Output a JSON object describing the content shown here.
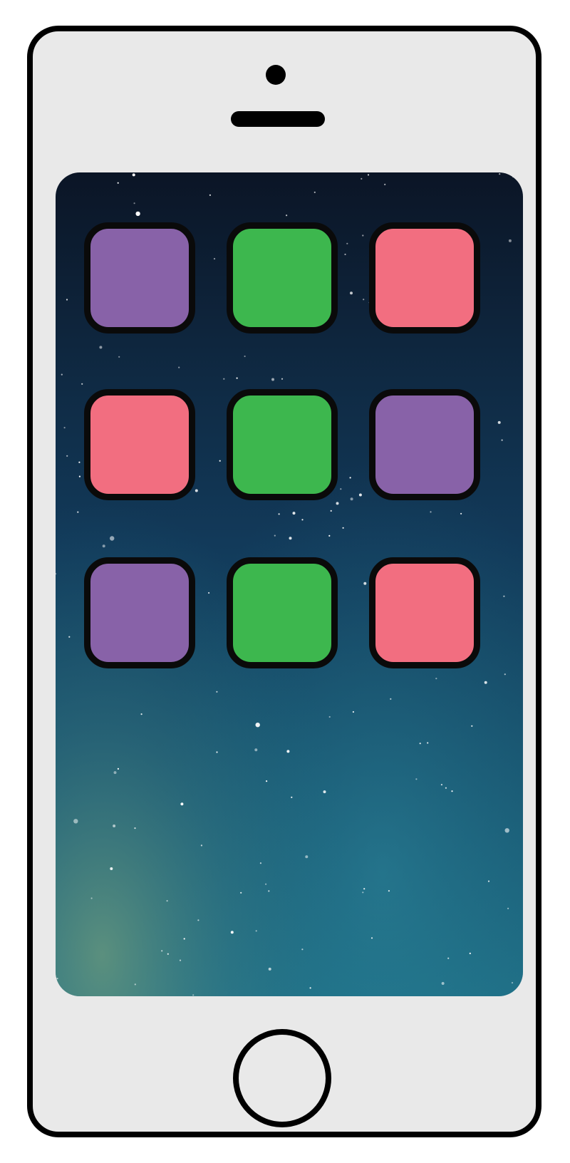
{
  "colors": {
    "phone_body": "#e9e9e9",
    "phone_outline": "#000000",
    "camera": "#000000",
    "speaker": "#000000",
    "wallpaper_top": "#0b1526",
    "wallpaper_mid": "#123a5a",
    "wallpaper_bottom": "#1f6f86",
    "purple": "#8862a8",
    "green": "#3db74e",
    "pink": "#f26e80"
  },
  "wallpaper": {
    "name": "starry-night-wallpaper"
  },
  "apps": [
    {
      "name": "app-icon-purple",
      "color": "#8862a8"
    },
    {
      "name": "app-icon-green",
      "color": "#3db74e"
    },
    {
      "name": "app-icon-pink",
      "color": "#f26e80"
    },
    {
      "name": "app-icon-pink",
      "color": "#f26e80"
    },
    {
      "name": "app-icon-green",
      "color": "#3db74e"
    },
    {
      "name": "app-icon-purple",
      "color": "#8862a8"
    },
    {
      "name": "app-icon-purple",
      "color": "#8862a8"
    },
    {
      "name": "app-icon-green",
      "color": "#3db74e"
    },
    {
      "name": "app-icon-pink",
      "color": "#f26e80"
    }
  ]
}
